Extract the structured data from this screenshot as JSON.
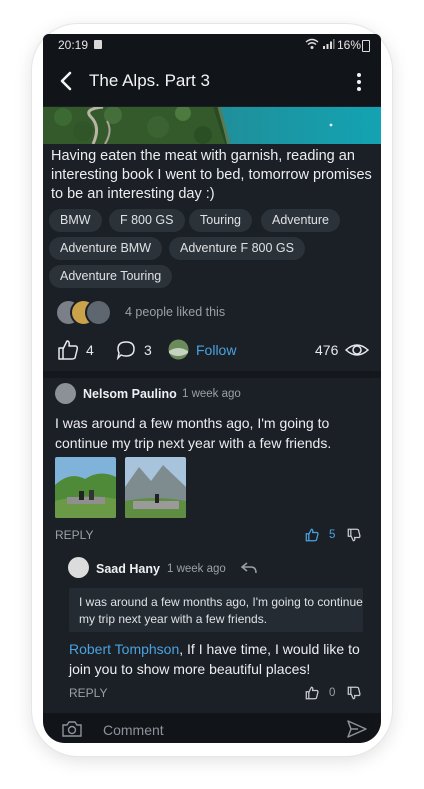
{
  "status_bar": {
    "time": "20:19",
    "battery": "16%"
  },
  "header": {
    "title": "The Alps. Part 3"
  },
  "post": {
    "description": "Having eaten the meat with garnish, reading an interesting book I went to bed, tomorrow promises to be an interesting day :)",
    "tags": [
      "BMW",
      "F 800 GS",
      "Touring",
      "Adventure",
      "Adventure BMW",
      "Adventure F 800 GS",
      "Adventure Touring"
    ],
    "likes_text": "4 people liked this",
    "likes_count": "4",
    "comments_count": "3",
    "follow_label": "Follow",
    "views_count": "476"
  },
  "comments": [
    {
      "author": "Nelsom Paulino",
      "time": "1 week ago",
      "text": "I was around a few months ago, I'm going to continue my trip next year with a few friends.",
      "reply_label": "REPLY",
      "likes": "5"
    }
  ],
  "reply": {
    "author": "Saad Hany",
    "time": "1 week ago",
    "quote": "I was around a few months ago, I'm going to continue my trip next year with a few friends.",
    "mention": "Robert Tomphson",
    "text": ", If I have time, I would like to join you to show more beautiful places!",
    "reply_label": "REPLY",
    "likes": "0"
  },
  "comment_bar": {
    "placeholder": "Comment"
  },
  "colors": {
    "background": "#1b1f26",
    "bar": "#111419",
    "accent": "#4aa3df",
    "chip": "#2c323a"
  }
}
